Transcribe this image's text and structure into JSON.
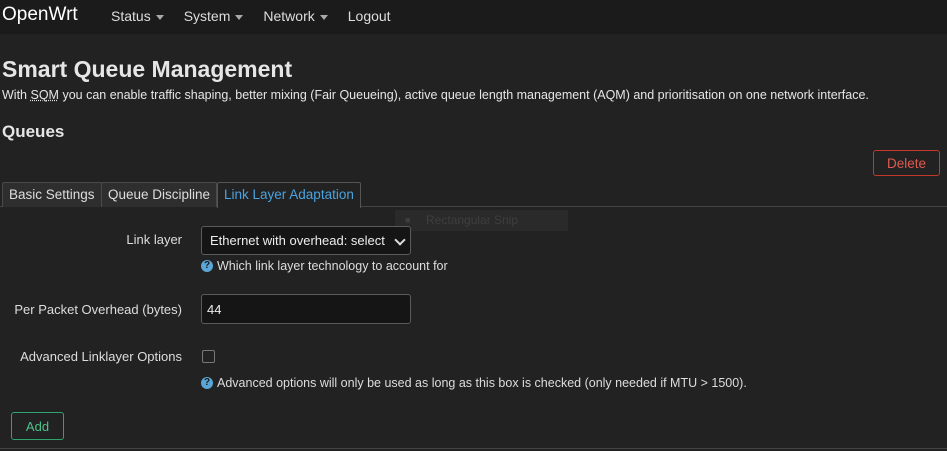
{
  "navbar": {
    "brand": "OpenWrt",
    "menu": [
      {
        "label": "Status",
        "has_dropdown": true
      },
      {
        "label": "System",
        "has_dropdown": true
      },
      {
        "label": "Network",
        "has_dropdown": true
      },
      {
        "label": "Logout",
        "has_dropdown": false
      }
    ]
  },
  "page": {
    "title": "Smart Queue Management",
    "description_prefix": "With ",
    "description_abbr": "SQM",
    "description_suffix": " you can enable traffic shaping, better mixing (Fair Queueing), active queue length management (AQM) and prioritisation on one network interface.",
    "section_title": "Queues",
    "delete_label": "Delete"
  },
  "tabs": [
    {
      "label": "Basic Settings",
      "active": false
    },
    {
      "label": "Queue Discipline",
      "active": false
    },
    {
      "label": "Link Layer Adaptation",
      "active": true
    }
  ],
  "ghost_tooltip": "Rectangular Snip",
  "form": {
    "link_layer": {
      "label": "Link layer",
      "value": "Ethernet with overhead: select",
      "help": "Which link layer technology to account for"
    },
    "overhead": {
      "label": "Per Packet Overhead (bytes)",
      "value": "44"
    },
    "advanced": {
      "label": "Advanced Linklayer Options",
      "checked": false,
      "help": "Advanced options will only be used as long as this box is checked (only needed if MTU > 1500)."
    }
  },
  "add_label": "Add",
  "colors": {
    "background": "#222222",
    "navbar": "#1b1b1b",
    "active_tab": "#4aa3df",
    "delete": "#e05a4f",
    "add": "#4cc38a",
    "help_icon": "#5aa6d6"
  }
}
